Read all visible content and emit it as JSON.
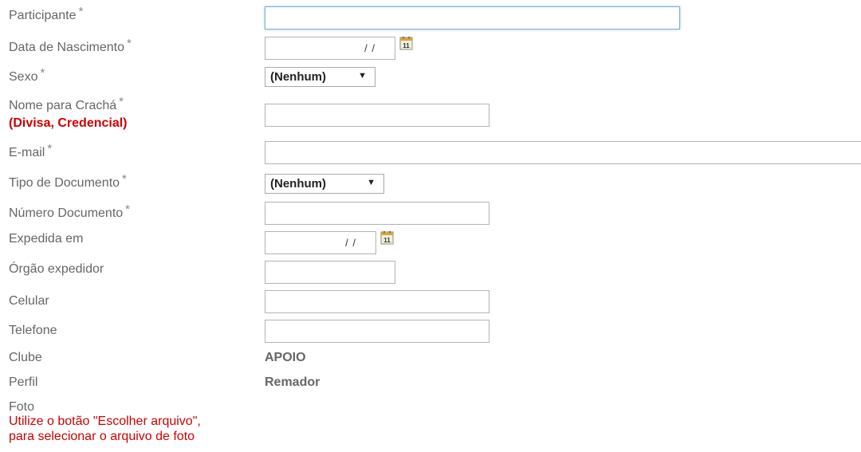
{
  "fields": {
    "participante": {
      "label": "Participante",
      "required": "*",
      "value": ""
    },
    "data_nascimento": {
      "label": "Data de Nascimento",
      "required": "*",
      "date_mask": "/ /"
    },
    "sexo": {
      "label": "Sexo",
      "required": "*",
      "selected": "(Nenhum)"
    },
    "nome_cracha": {
      "label": "Nome para Crachá",
      "required": "*",
      "hint": "(Divisa, Credencial)",
      "value": ""
    },
    "email": {
      "label": "E-mail",
      "required": "*",
      "value": ""
    },
    "tipo_documento": {
      "label": "Tipo de Documento",
      "required": "*",
      "selected": "(Nenhum)"
    },
    "numero_documento": {
      "label": "Número Documento",
      "required": "*",
      "value": ""
    },
    "expedida_em": {
      "label": "Expedida em",
      "date_mask": "/ /"
    },
    "orgao_expedidor": {
      "label": "Órgão expedidor",
      "value": ""
    },
    "celular": {
      "label": "Celular",
      "value": ""
    },
    "telefone": {
      "label": "Telefone",
      "value": ""
    },
    "clube": {
      "label": "Clube",
      "value": "APOIO"
    },
    "perfil": {
      "label": "Perfil",
      "value": "Remador"
    },
    "foto": {
      "label": "Foto",
      "hint_line1": "Utilize o botão \"Escolher arquivo\",",
      "hint_line2": "para selecionar o arquivo de foto"
    }
  },
  "icons": {
    "calendar": "calendar-icon",
    "dropdown": "chevron-down-icon"
  },
  "colors": {
    "hint_red": "#cc0000",
    "focus_border": "#7eaddc",
    "label_gray": "#666666"
  }
}
